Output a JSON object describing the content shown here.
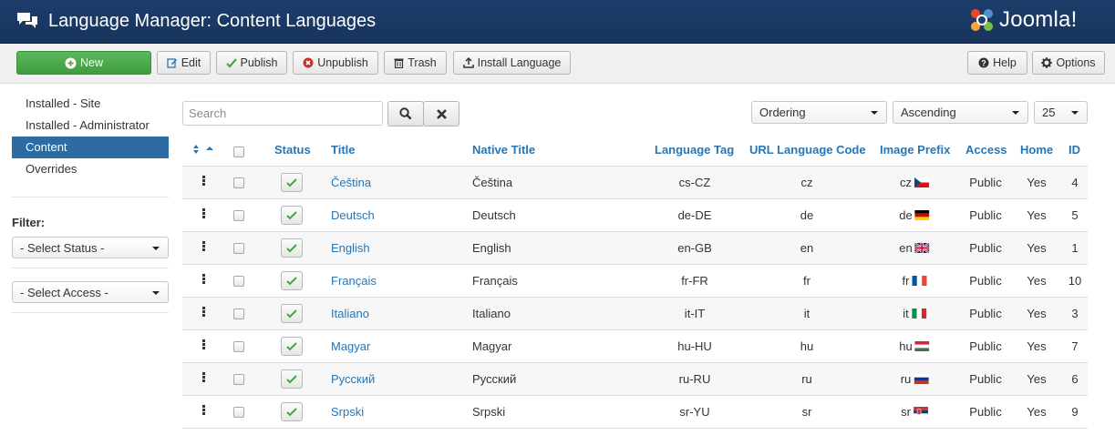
{
  "header": {
    "title": "Language Manager: Content Languages",
    "logo_text": "Joomla!"
  },
  "toolbar": {
    "new": "New",
    "edit": "Edit",
    "publish": "Publish",
    "unpublish": "Unpublish",
    "trash": "Trash",
    "install": "Install Language",
    "help": "Help",
    "options": "Options"
  },
  "sidebar": {
    "items": [
      {
        "label": "Installed - Site",
        "active": false
      },
      {
        "label": "Installed - Administrator",
        "active": false
      },
      {
        "label": "Content",
        "active": true
      },
      {
        "label": "Overrides",
        "active": false
      }
    ],
    "filter_label": "Filter:",
    "status_select": "- Select Status -",
    "access_select": "- Select Access -"
  },
  "search": {
    "placeholder": "Search",
    "value": ""
  },
  "list_controls": {
    "ordering": "Ordering",
    "direction": "Ascending",
    "limit": "25"
  },
  "table": {
    "columns": {
      "status": "Status",
      "title": "Title",
      "native_title": "Native Title",
      "language_tag": "Language Tag",
      "url_code": "URL Language Code",
      "image_prefix": "Image Prefix",
      "access": "Access",
      "home": "Home",
      "id": "ID"
    },
    "rows": [
      {
        "title": "Čeština",
        "native": "Čeština",
        "tag": "cs-CZ",
        "code": "cz",
        "prefix": "cz",
        "flag": "cz",
        "access": "Public",
        "home": "Yes",
        "id": "4"
      },
      {
        "title": "Deutsch",
        "native": "Deutsch",
        "tag": "de-DE",
        "code": "de",
        "prefix": "de",
        "flag": "de",
        "access": "Public",
        "home": "Yes",
        "id": "5"
      },
      {
        "title": "English",
        "native": "English",
        "tag": "en-GB",
        "code": "en",
        "prefix": "en",
        "flag": "gb",
        "access": "Public",
        "home": "Yes",
        "id": "1"
      },
      {
        "title": "Français",
        "native": "Français",
        "tag": "fr-FR",
        "code": "fr",
        "prefix": "fr",
        "flag": "fr",
        "access": "Public",
        "home": "Yes",
        "id": "10"
      },
      {
        "title": "Italiano",
        "native": "Italiano",
        "tag": "it-IT",
        "code": "it",
        "prefix": "it",
        "flag": "it",
        "access": "Public",
        "home": "Yes",
        "id": "3"
      },
      {
        "title": "Magyar",
        "native": "Magyar",
        "tag": "hu-HU",
        "code": "hu",
        "prefix": "hu",
        "flag": "hu",
        "access": "Public",
        "home": "Yes",
        "id": "7"
      },
      {
        "title": "Русский",
        "native": "Русский",
        "tag": "ru-RU",
        "code": "ru",
        "prefix": "ru",
        "flag": "ru",
        "access": "Public",
        "home": "Yes",
        "id": "6"
      },
      {
        "title": "Srpski",
        "native": "Srpski",
        "tag": "sr-YU",
        "code": "sr",
        "prefix": "sr",
        "flag": "rs",
        "access": "Public",
        "home": "Yes",
        "id": "9"
      }
    ]
  },
  "colors": {
    "header_bg": "#1d3d6b",
    "link": "#2a75b3",
    "active_nav": "#2d6ca2",
    "new_button": "#5cb85c",
    "check": "#46a546"
  }
}
